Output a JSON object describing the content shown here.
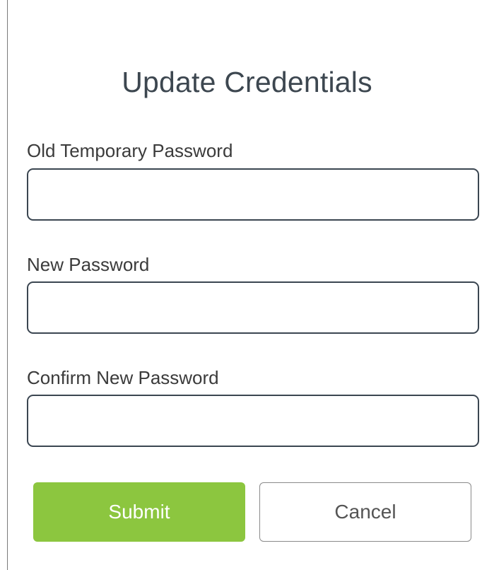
{
  "dialog": {
    "title": "Update Credentials"
  },
  "form": {
    "fields": [
      {
        "label": "Old Temporary Password",
        "value": "",
        "placeholder": ""
      },
      {
        "label": "New Password",
        "value": "",
        "placeholder": ""
      },
      {
        "label": "Confirm New Password",
        "value": "",
        "placeholder": ""
      }
    ]
  },
  "actions": {
    "submit_label": "Submit",
    "cancel_label": "Cancel"
  },
  "colors": {
    "submit_bg": "#8cc63f",
    "input_border": "#3b4651"
  }
}
